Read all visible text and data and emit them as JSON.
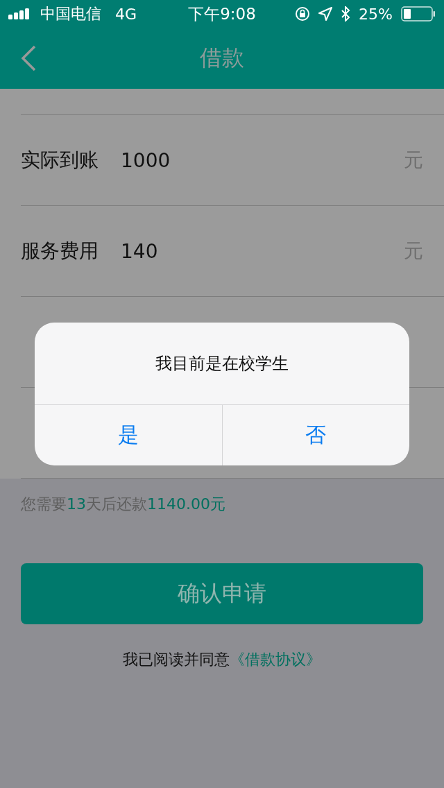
{
  "status_bar": {
    "carrier": "中国电信",
    "network": "4G",
    "time": "下午9:08",
    "battery_percent": "25%"
  },
  "nav": {
    "title": "借款"
  },
  "form_rows": [
    {},
    {
      "label": "实际到账",
      "value": "1000",
      "unit": "元"
    },
    {
      "label": "服务费用",
      "value": "140",
      "unit": "元"
    },
    {},
    {}
  ],
  "repay_note": {
    "prefix": "您需要",
    "days": "13",
    "middle": "天后还款",
    "amount": "1140.00元"
  },
  "confirm_button": "确认申请",
  "agreement": {
    "text": "我已阅读并同意",
    "link": "《借款协议》"
  },
  "dialog": {
    "message": "我目前是在校学生",
    "buttons": [
      "是",
      "否"
    ]
  }
}
